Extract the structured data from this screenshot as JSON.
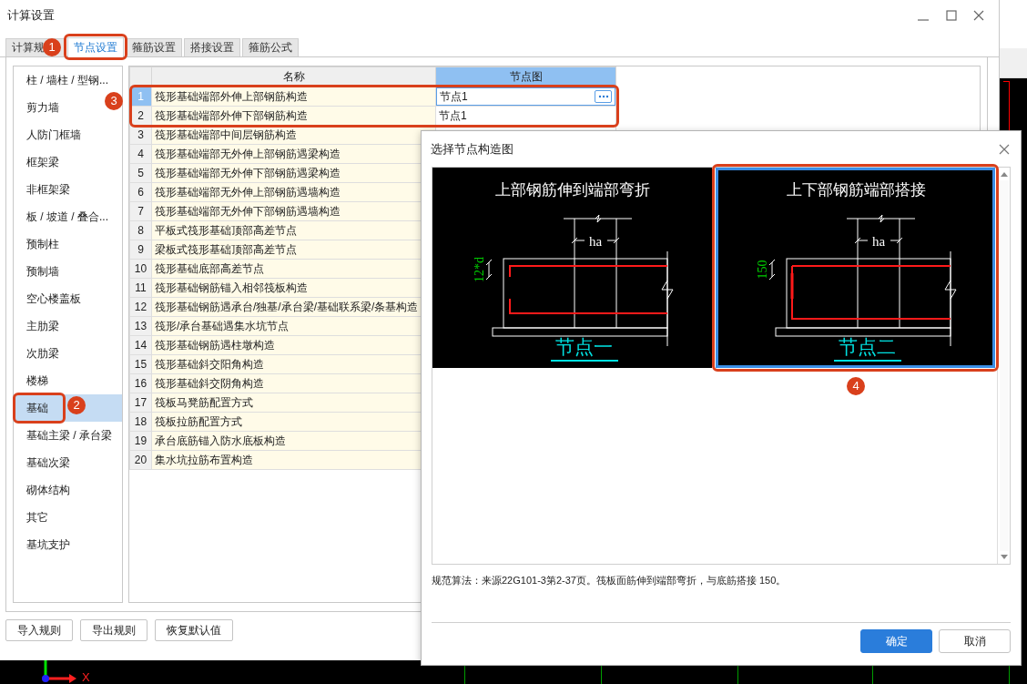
{
  "window": {
    "title": "计算设置"
  },
  "tabs": [
    {
      "label": "计算规",
      "selected": false
    },
    {
      "label": "节点设置",
      "selected": true
    },
    {
      "label": "箍筋设置",
      "selected": false
    },
    {
      "label": "搭接设置",
      "selected": false
    },
    {
      "label": "箍筋公式",
      "selected": false
    }
  ],
  "categories": [
    {
      "label": "柱 / 墙柱 / 型钢...",
      "selected": false
    },
    {
      "label": "剪力墙",
      "selected": false
    },
    {
      "label": "人防门框墙",
      "selected": false
    },
    {
      "label": "框架梁",
      "selected": false
    },
    {
      "label": "非框架梁",
      "selected": false
    },
    {
      "label": "板 / 坡道 / 叠合...",
      "selected": false
    },
    {
      "label": "预制柱",
      "selected": false
    },
    {
      "label": "预制墙",
      "selected": false
    },
    {
      "label": "空心楼盖板",
      "selected": false
    },
    {
      "label": "主肋梁",
      "selected": false
    },
    {
      "label": "次肋梁",
      "selected": false
    },
    {
      "label": "楼梯",
      "selected": false
    },
    {
      "label": "基础",
      "selected": true
    },
    {
      "label": "基础主梁 / 承台梁",
      "selected": false
    },
    {
      "label": "基础次梁",
      "selected": false
    },
    {
      "label": "砌体结构",
      "selected": false
    },
    {
      "label": "其它",
      "selected": false
    },
    {
      "label": "基坑支护",
      "selected": false
    }
  ],
  "table": {
    "columns": [
      {
        "label": "名称",
        "selected": false
      },
      {
        "label": "节点图",
        "selected": true
      }
    ],
    "rows": [
      {
        "number": "1",
        "name": "筏形基础端部外伸上部钢筋构造",
        "node": "节点1",
        "selected": true
      },
      {
        "number": "2",
        "name": "筏形基础端部外伸下部钢筋构造",
        "node": "节点1",
        "selected": false
      },
      {
        "number": "3",
        "name": "筏形基础端部中间层钢筋构造",
        "selected": false
      },
      {
        "number": "4",
        "name": "筏形基础端部无外伸上部钢筋遇梁构造",
        "selected": false
      },
      {
        "number": "5",
        "name": "筏形基础端部无外伸下部钢筋遇梁构造",
        "selected": false
      },
      {
        "number": "6",
        "name": "筏形基础端部无外伸上部钢筋遇墙构造",
        "selected": false
      },
      {
        "number": "7",
        "name": "筏形基础端部无外伸下部钢筋遇墙构造",
        "selected": false
      },
      {
        "number": "8",
        "name": "平板式筏形基础顶部高差节点",
        "selected": false
      },
      {
        "number": "9",
        "name": "梁板式筏形基础顶部高差节点",
        "selected": false
      },
      {
        "number": "10",
        "name": "筏形基础底部高差节点",
        "selected": false
      },
      {
        "number": "11",
        "name": "筏形基础钢筋锚入相邻筏板构造",
        "selected": false
      },
      {
        "number": "12",
        "name": "筏形基础钢筋遇承台/独基/承台梁/基础联系梁/条基构造",
        "selected": false
      },
      {
        "number": "13",
        "name": "筏形/承台基础遇集水坑节点",
        "selected": false
      },
      {
        "number": "14",
        "name": "筏形基础钢筋遇柱墩构造",
        "selected": false
      },
      {
        "number": "15",
        "name": "筏形基础斜交阳角构造",
        "selected": false
      },
      {
        "number": "16",
        "name": "筏形基础斜交阴角构造",
        "selected": false
      },
      {
        "number": "17",
        "name": "筏板马凳筋配置方式",
        "selected": false
      },
      {
        "number": "18",
        "name": "筏板拉筋配置方式",
        "selected": false
      },
      {
        "number": "19",
        "name": "承台底筋锚入防水底板构造",
        "selected": false
      },
      {
        "number": "20",
        "name": "集水坑拉筋布置构造",
        "selected": false
      }
    ]
  },
  "buttons": [
    "导入规则",
    "导出规则",
    "恢复默认值"
  ],
  "dialog": {
    "title": "选择节点构造图",
    "options": [
      {
        "kind": "bend",
        "title": "上部钢筋伸到端部弯折",
        "dimension": "ha",
        "side_dimension": "12*d",
        "caption": "节点一",
        "selected": false
      },
      {
        "kind": "lap",
        "title": "上下部钢筋端部搭接",
        "dimension": "ha",
        "side_dimension": "150",
        "caption": "节点二",
        "selected": true
      }
    ],
    "description": "规范算法：来源22G101-3第2-37页。筏板面筋伸到端部弯折，与底筋搭接 150。",
    "buttons": [
      {
        "label": "确定",
        "kind": "primary"
      },
      {
        "label": "取消",
        "kind": "secondary"
      }
    ]
  },
  "annotations": [
    "1",
    "2",
    "3",
    "4"
  ],
  "cad_view": {
    "axis_label": "X"
  }
}
